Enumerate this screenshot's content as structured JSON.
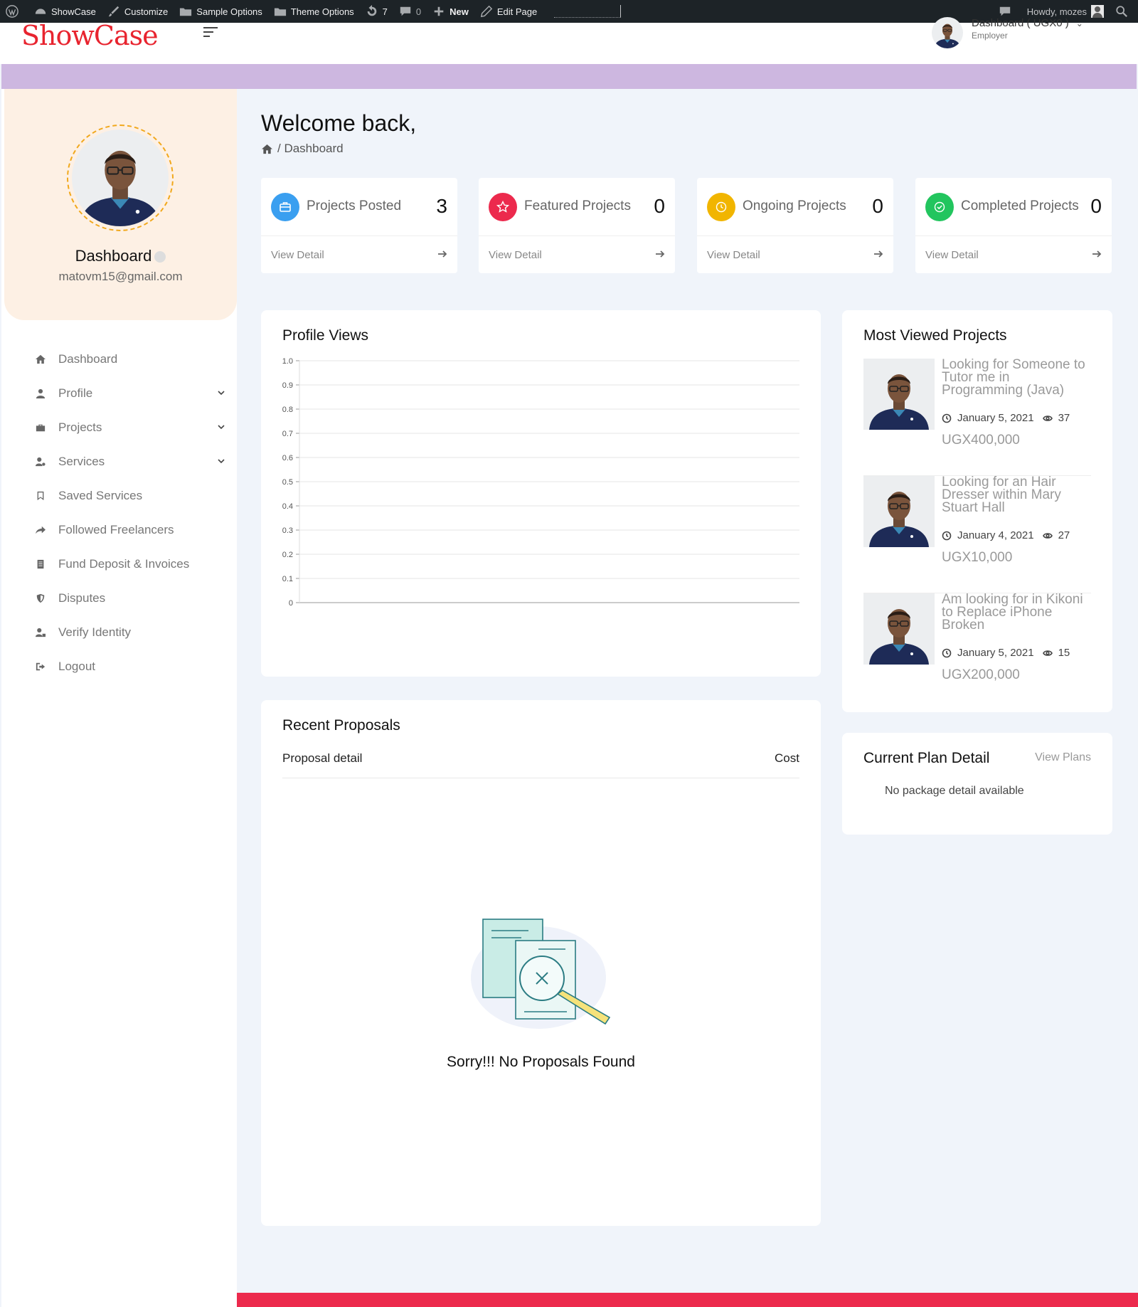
{
  "adminbar": {
    "site_name": "ShowCase",
    "customize": "Customize",
    "sample_options": "Sample Options",
    "theme_options": "Theme Options",
    "updates_count": "7",
    "comments_count": "0",
    "new_label": "New",
    "edit_page": "Edit Page",
    "howdy": "Howdy, mozes"
  },
  "header": {
    "logo": "ShowCase",
    "user_name": "Dashboard ( UGX0 )",
    "user_role": "Employer"
  },
  "profile": {
    "name": "Dashboard",
    "email": "matovm15@gmail.com"
  },
  "sidebar": {
    "items": [
      {
        "label": "Dashboard",
        "icon": "home-icon",
        "has_submenu": false
      },
      {
        "label": "Profile",
        "icon": "user-icon",
        "has_submenu": true
      },
      {
        "label": "Projects",
        "icon": "briefcase-icon",
        "has_submenu": true
      },
      {
        "label": "Services",
        "icon": "user-gear-icon",
        "has_submenu": true
      },
      {
        "label": "Saved Services",
        "icon": "bookmark-icon",
        "has_submenu": false
      },
      {
        "label": "Followed Freelancers",
        "icon": "share-icon",
        "has_submenu": false
      },
      {
        "label": "Fund Deposit & Invoices",
        "icon": "invoice-icon",
        "has_submenu": false
      },
      {
        "label": "Disputes",
        "icon": "shield-icon",
        "has_submenu": false
      },
      {
        "label": "Verify Identity",
        "icon": "user-lock-icon",
        "has_submenu": false
      },
      {
        "label": "Logout",
        "icon": "logout-icon",
        "has_submenu": false
      }
    ]
  },
  "main": {
    "welcome": "Welcome back,",
    "breadcrumb": "/ Dashboard"
  },
  "stats": [
    {
      "label": "Projects Posted",
      "value": "3",
      "link": "View Detail",
      "color": "#3a9ff0",
      "icon": "briefcase-icon"
    },
    {
      "label": "Featured Projects",
      "value": "0",
      "link": "View Detail",
      "color": "#ec2a4d",
      "icon": "star-icon"
    },
    {
      "label": "Ongoing Projects",
      "value": "0",
      "link": "View Detail",
      "color": "#f1b500",
      "icon": "clock-icon"
    },
    {
      "label": "Completed Projects",
      "value": "0",
      "link": "View Detail",
      "color": "#22c55e",
      "icon": "check-circle-icon"
    }
  ],
  "profile_views": {
    "title": "Profile Views",
    "chart_data": {
      "type": "line",
      "x": [],
      "series": [],
      "ylim": [
        0,
        1.0
      ],
      "y_ticks": [
        "1.0",
        "0.9",
        "0.8",
        "0.7",
        "0.6",
        "0.5",
        "0.4",
        "0.3",
        "0.2",
        "0.1",
        "0"
      ],
      "grid": true
    }
  },
  "proposals": {
    "title": "Recent Proposals",
    "col_detail": "Proposal detail",
    "col_cost": "Cost",
    "empty": "Sorry!!! No Proposals Found"
  },
  "most_viewed": {
    "title": "Most Viewed Projects",
    "items": [
      {
        "title": "Looking for Someone to Tutor me in Programming (Java)",
        "date": "January 5, 2021",
        "views": "37",
        "price": "UGX400,000"
      },
      {
        "title": "Looking for an Hair Dresser within Mary Stuart Hall",
        "date": "January 4, 2021",
        "views": "27",
        "price": "UGX10,000"
      },
      {
        "title": "Am looking for in Kikoni to Replace iPhone Broken",
        "date": "January 5, 2021",
        "views": "15",
        "price": "UGX200,000"
      }
    ]
  },
  "plan": {
    "title": "Current Plan Detail",
    "link": "View Plans",
    "empty": "No package detail available"
  },
  "colors": {
    "accent_red": "#ec2a4d",
    "band_purple": "#cdb7e0",
    "profile_bg": "#fdf0e4"
  }
}
